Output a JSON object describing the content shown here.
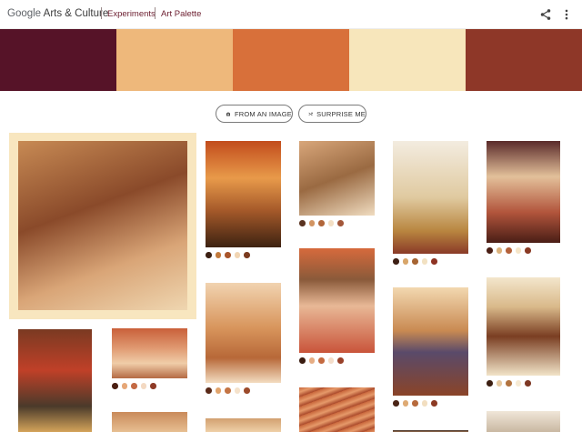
{
  "header": {
    "brand_google": "Google",
    "brand_rest": " Arts & Culture",
    "crumb_experiments": "Experiments",
    "crumb_app": "Art Palette",
    "share_icon": "share-icon",
    "menu_icon": "more-vert-icon"
  },
  "palette": {
    "colors": [
      "#561328",
      "#eeb87b",
      "#d8703a",
      "#f7e6bb",
      "#8e3728"
    ]
  },
  "actions": {
    "from_image_label": "FROM AN IMAGE",
    "surprise_label": "SURPRISE ME"
  },
  "tiles": [
    {
      "name": "selected-photo-boy",
      "bg": "linear-gradient(160deg,#c78a54 0%,#8a4a2a 40%,#d9a577 70%,#efd6b0 100%)",
      "dots": []
    },
    {
      "name": "artwork-face-painting",
      "bg": "linear-gradient(180deg,#c24c1c 0%,#e89a4a 35%,#a65a2a 65%,#3d2211 100%)",
      "dots": [
        "#3b1f12",
        "#c27a3c",
        "#a9552a",
        "#f1d5b3",
        "#7a3b1f"
      ]
    },
    {
      "name": "artwork-still-life",
      "bg": "linear-gradient(160deg,#d8a67a 0%,#9a6a42 50%,#f0dcc0 100%)",
      "dots": [
        "#5a3320",
        "#d29462",
        "#b1663a",
        "#f3dfc4",
        "#a3573a"
      ]
    },
    {
      "name": "artwork-porcelain-stove",
      "bg": "linear-gradient(180deg,#f3ece0 0%,#e0caa0 50%,#b8853f 80%,#8a3a28 100%)",
      "dots": [
        "#3c1f14",
        "#d8a66a",
        "#a66432",
        "#f2e1c2",
        "#8e3323"
      ]
    },
    {
      "name": "artwork-woman-portrait",
      "bg": "linear-gradient(180deg,#5a2a2a 0%,#e3c09a 35%,#b2553c 70%,#4a1e16 100%)",
      "dots": [
        "#4a1e14",
        "#dcb27c",
        "#b4613a",
        "#f5e5c8",
        "#8a3a24"
      ]
    },
    {
      "name": "artwork-man-red-hat",
      "bg": "linear-gradient(180deg,#7a3a22 0%,#c04028 40%,#4a3a2a 75%,#d4a45a 100%)",
      "dots": []
    },
    {
      "name": "artwork-arena-scene",
      "bg": "linear-gradient(180deg,#c9603a 0%,#e09a72 40%,#f0cda8 70%,#b46a44 100%)",
      "dots": [
        "#4b1f12",
        "#e6a777",
        "#c46a44",
        "#f3d9c2",
        "#8e3a26"
      ]
    },
    {
      "name": "artwork-tree-drawing",
      "bg": "linear-gradient(180deg,#f1d3b0 0%,#d8955c 45%,#b76838 75%,#f3dcc0 100%)",
      "dots": [
        "#5a2a18",
        "#e1a46c",
        "#c47444",
        "#f5e2cb",
        "#9c4a2a"
      ]
    },
    {
      "name": "artwork-man-photo",
      "bg": "linear-gradient(180deg,#d66a3c 0%,#8a5a3a 30%,#e8b896 55%,#c9543a 100%)",
      "dots": [
        "#3a1c10",
        "#e6ad84",
        "#c46a40",
        "#f4ddca",
        "#99412a"
      ]
    },
    {
      "name": "artwork-religious-scene",
      "bg": "linear-gradient(180deg,#f2d8b0 0%,#c98a52 40%,#5a4a6a 60%,#8a4428 100%)",
      "dots": [
        "#4a2416",
        "#deaa74",
        "#b76a3c",
        "#f2dec0",
        "#8c3a24"
      ]
    },
    {
      "name": "artwork-wood-cabinet",
      "bg": "linear-gradient(180deg,#f3e6cc 0%,#d9b98a 30%,#7a3e22 60%,#f2e4c8 100%)",
      "dots": [
        "#3c1f12",
        "#e6c9a0",
        "#b2733f",
        "#f6ead4",
        "#7e3824"
      ]
    },
    {
      "name": "artwork-bottom-1",
      "bg": "linear-gradient(180deg,#c98a5a 0%,#e7bf92 100%)",
      "dots": []
    },
    {
      "name": "artwork-bottom-2",
      "bg": "linear-gradient(180deg,#d2a070 0%,#efd0a8 100%)",
      "dots": []
    },
    {
      "name": "artwork-copper-rods",
      "bg": "repeating-linear-gradient(160deg,#c8653a 0px,#e69a6a 5px,#a8482a 10px)",
      "dots": []
    },
    {
      "name": "artwork-bottom-4",
      "bg": "linear-gradient(180deg,#3a2a22 0%,#9a7050 100%)",
      "dots": []
    },
    {
      "name": "artwork-bottom-5",
      "bg": "linear-gradient(180deg,#f0e6d8 0%,#c9b8a2 100%)",
      "dots": []
    }
  ]
}
